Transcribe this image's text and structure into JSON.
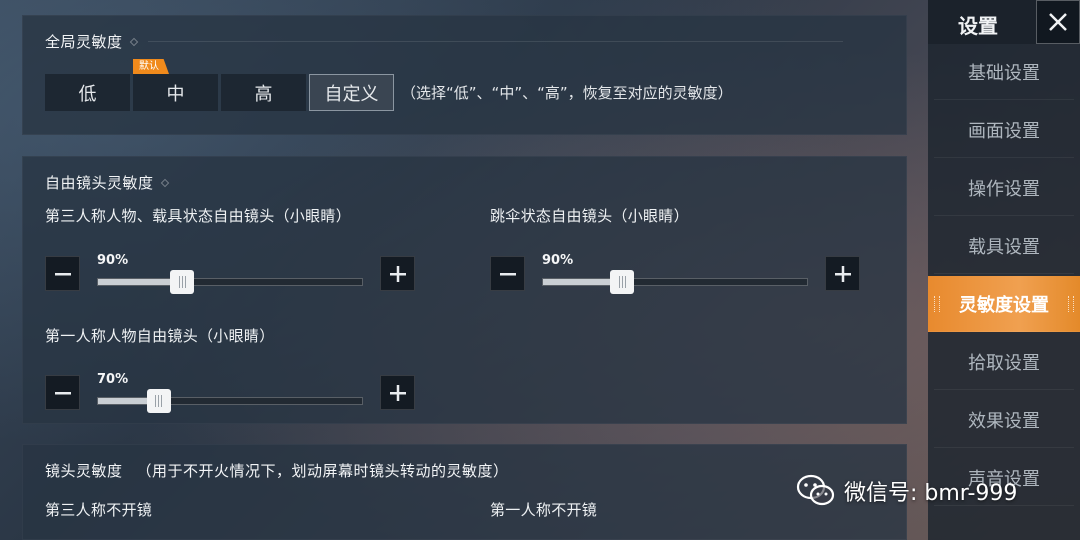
{
  "global_sensitivity": {
    "title": "全局灵敏度",
    "levels": [
      "低",
      "中",
      "高",
      "自定义"
    ],
    "default_tag": "默认",
    "hint": "（选择“低”、“中”、“高”，恢复至对应的灵敏度）"
  },
  "free_look": {
    "title": "自由镜头灵敏度",
    "sliders": [
      {
        "label": "第三人称人物、载具状态自由镜头（小眼睛）",
        "value_text": "90%",
        "value": 0.32
      },
      {
        "label": "跳伞状态自由镜头（小眼睛）",
        "value_text": "90%",
        "value": 0.3
      },
      {
        "label": "第一人称人物自由镜头（小眼睛）",
        "value_text": "70%",
        "value": 0.23
      }
    ]
  },
  "camera_sensitivity": {
    "title": "镜头灵敏度",
    "subtitle": "（用于不开火情况下，划动屏幕时镜头转动的灵敏度）",
    "items": [
      "第三人称不开镜",
      "第一人称不开镜"
    ]
  },
  "sidebar": {
    "title": "设置",
    "items": [
      "基础设置",
      "画面设置",
      "操作设置",
      "载具设置",
      "灵敏度设置",
      "拾取设置",
      "效果设置",
      "声音设置"
    ],
    "active_index": 4
  },
  "watermark": {
    "text": "微信号: bmr-999"
  },
  "colors": {
    "accent": "#f08a1c",
    "panel": "#283442",
    "button_dark": "#1d2732"
  }
}
